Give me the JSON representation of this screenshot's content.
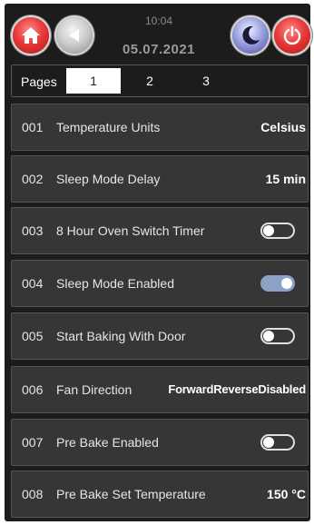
{
  "header": {
    "time": "10:04",
    "date": "05.07.2021",
    "home_icon": "home-icon",
    "back_icon": "back-arrow-icon",
    "sleep_icon": "moon-icon",
    "power_icon": "power-icon"
  },
  "pages": {
    "label": "Pages",
    "tabs": [
      "1",
      "2",
      "3"
    ],
    "active": "1"
  },
  "settings": [
    {
      "num": "001",
      "label": "Temperature Units",
      "type": "value",
      "value": "Celsius"
    },
    {
      "num": "002",
      "label": "Sleep Mode Delay",
      "type": "value",
      "value": "15 min"
    },
    {
      "num": "003",
      "label": "8 Hour Oven Switch Timer",
      "type": "toggle",
      "on": false
    },
    {
      "num": "004",
      "label": "Sleep Mode Enabled",
      "type": "toggle",
      "on": true
    },
    {
      "num": "005",
      "label": "Start Baking With Door",
      "type": "toggle",
      "on": false
    },
    {
      "num": "006",
      "label": "Fan Direction",
      "type": "value",
      "value": "ForwardReverseDisabled"
    },
    {
      "num": "007",
      "label": "Pre Bake Enabled",
      "type": "toggle",
      "on": false
    },
    {
      "num": "008",
      "label": "Pre Bake Set Temperature",
      "type": "value",
      "value": "150 °C"
    }
  ],
  "colors": {
    "background": "#1c1c1c",
    "row": "#363636",
    "toggle_on": "#8da2c4",
    "accent_red": "#e83a3a"
  }
}
